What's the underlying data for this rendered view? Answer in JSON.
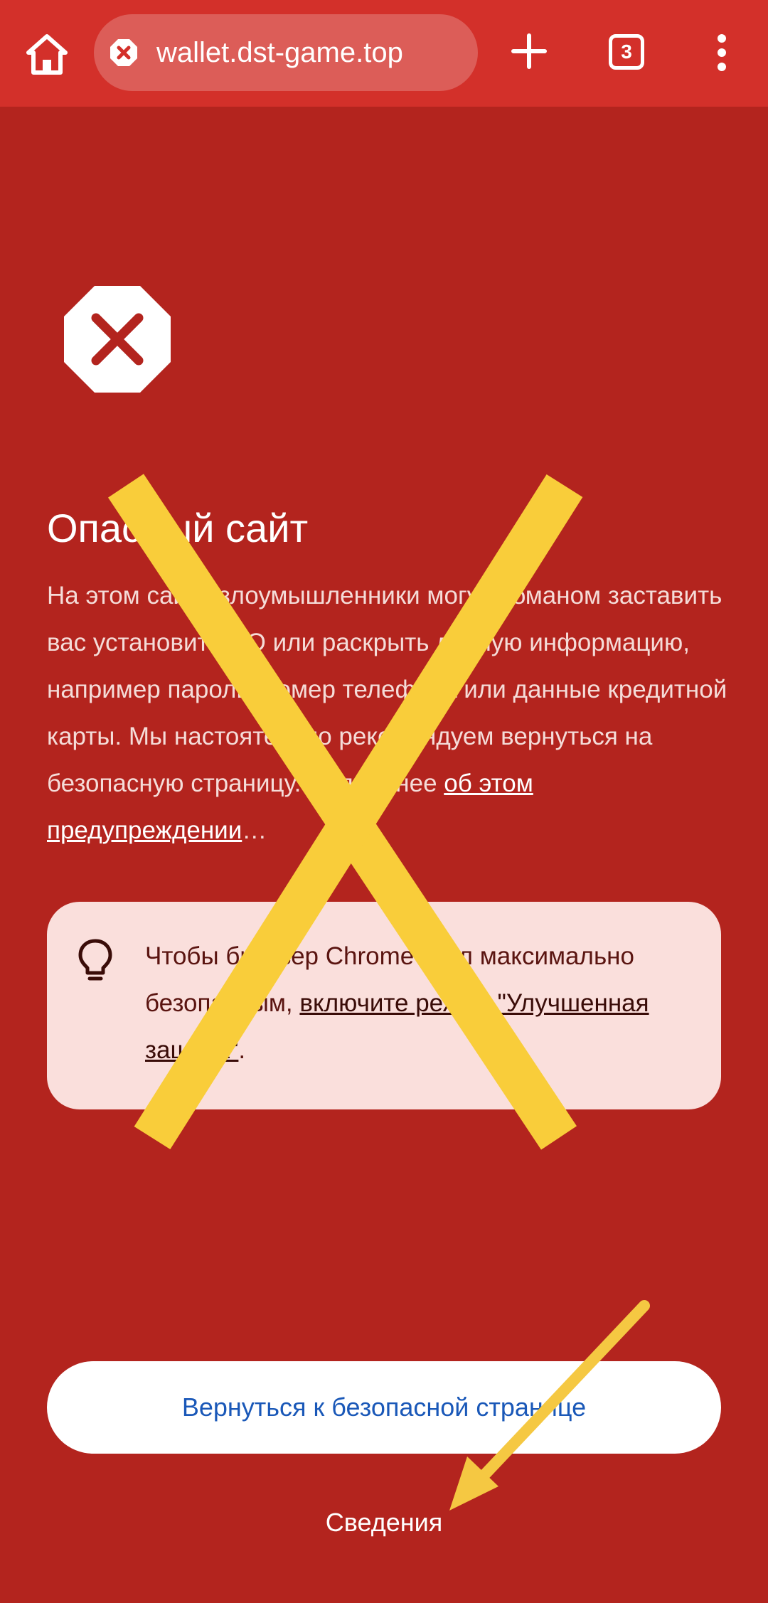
{
  "toolbar": {
    "home_icon": "home-icon",
    "url": "wallet.dst-game.top",
    "site_status_icon": "dangerous-site-icon",
    "new_tab_icon": "plus-icon",
    "tab_count": "3",
    "menu_icon": "more-vert-icon"
  },
  "warning": {
    "icon": "stop-sign-x-icon",
    "title": "Опасный сайт",
    "body": "На этом сайте злоумышленники могут обманом заставить вас установить ПО или раскрыть личную информацию, например пароль, номер телефона или данные кредитной карты. Мы настоятельно рекомендуем вернуться на безопасную страницу. Подробнее ",
    "learn_more_link": "об этом предупреждении",
    "learn_more_suffix": "…"
  },
  "tip": {
    "icon": "lightbulb-icon",
    "text": "Чтобы браузер Chrome стал максимально безопасным, ",
    "link": "включите режим \"Улучшенная защита\"",
    "suffix": "."
  },
  "actions": {
    "back_button": "Вернуться к безопасной странице",
    "details_link": "Сведения"
  },
  "colors": {
    "page_background": "#b3241e",
    "toolbar_background": "#d3302a",
    "overlay_x": "#f9cd3a",
    "overlay_arrow": "#f5c842"
  }
}
